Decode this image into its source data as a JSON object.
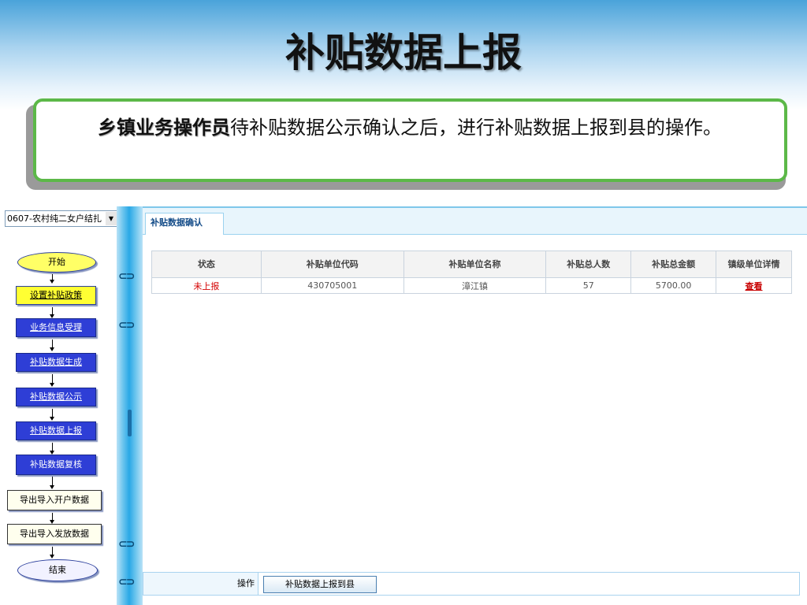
{
  "slide": {
    "title": "补贴数据上报",
    "callout_strong": "乡镇业务操作员",
    "callout_rest": "待补贴数据公示确认之后，进行补贴数据上报到县的操作。"
  },
  "left": {
    "select_value": "0607-农村纯二女户结扎",
    "flow": [
      {
        "label": "开始",
        "style": "oval"
      },
      {
        "label": "设置补贴政策",
        "style": "yellow"
      },
      {
        "label": "业务信息受理",
        "style": "blue"
      },
      {
        "label": "补贴数据生成",
        "style": "blue"
      },
      {
        "label": "补贴数据公示",
        "style": "blue"
      },
      {
        "label": "补贴数据上报",
        "style": "blue"
      },
      {
        "label": "补贴数据复核",
        "style": "blue-plain"
      },
      {
        "label": "导出导入开户数据",
        "style": "white"
      },
      {
        "label": "导出导入发放数据",
        "style": "white"
      },
      {
        "label": "结束",
        "style": "end"
      }
    ]
  },
  "tab": {
    "label": "补贴数据确认"
  },
  "table": {
    "headers": [
      "状态",
      "补贴单位代码",
      "补贴单位名称",
      "补贴总人数",
      "补贴总金额",
      "镇级单位详情"
    ],
    "rows": [
      {
        "status": "未上报",
        "code": "430705001",
        "name": "漳江镇",
        "count": "57",
        "amount": "5700.00",
        "link": "查看"
      }
    ]
  },
  "action": {
    "label": "操作",
    "button": "补贴数据上报到县"
  },
  "colors": {
    "accent_green": "#5cb848",
    "header_blue": "#4aa3da",
    "flow_blue": "#2e3ed6",
    "status_red": "#d40000"
  }
}
